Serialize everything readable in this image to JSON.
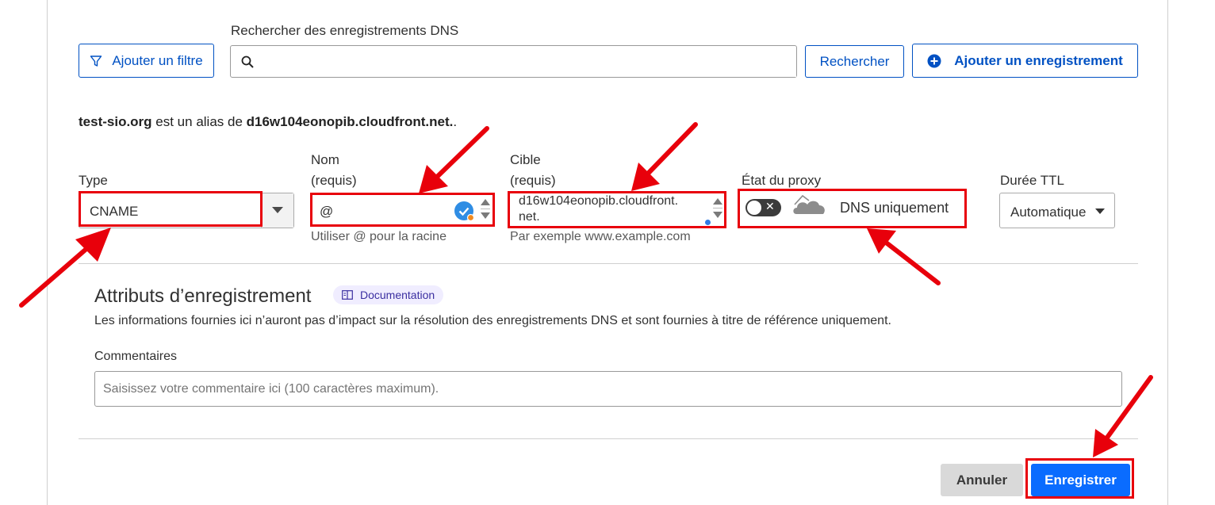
{
  "search": {
    "label": "Rechercher des enregistrements DNS",
    "value": "",
    "placeholder": ""
  },
  "toolbar": {
    "add_filter": "Ajouter un filtre",
    "search_button": "Rechercher",
    "add_record": "Ajouter un enregistrement"
  },
  "alias_note": {
    "domain": "test-sio.org",
    "middle": " est un alias de ",
    "target": "d16w104eonopib.cloudfront.net.",
    "trailing": "."
  },
  "form": {
    "type": {
      "label": "Type",
      "value": "CNAME"
    },
    "name": {
      "label1": "Nom",
      "label2": "(requis)",
      "value": "@",
      "hint": "Utiliser @ pour la racine"
    },
    "target": {
      "label1": "Cible",
      "label2": "(requis)",
      "value_line1": "d16w104eonopib.cloudfront.",
      "value_line2": "net.",
      "hint": "Par exemple www.example.com"
    },
    "proxy": {
      "label": "État du proxy",
      "status": "DNS uniquement",
      "enabled": false
    },
    "ttl": {
      "label": "Durée TTL",
      "value": "Automatique"
    }
  },
  "attributes": {
    "title": "Attributs d’enregistrement",
    "doc_badge": "Documentation",
    "description": "Les informations fournies ici n’auront pas d’impact sur la résolution des enregistrements DNS et sont fournies à titre de référence uniquement.",
    "comments_label": "Commentaires",
    "comments_placeholder": "Saisissez votre commentaire ici (100 caractères maximum).",
    "comments_value": ""
  },
  "actions": {
    "cancel": "Annuler",
    "save": "Enregistrer"
  },
  "colors": {
    "accent": "#0051c3",
    "primary_button": "#0a6cff",
    "annotation_red": "#e8000b"
  }
}
